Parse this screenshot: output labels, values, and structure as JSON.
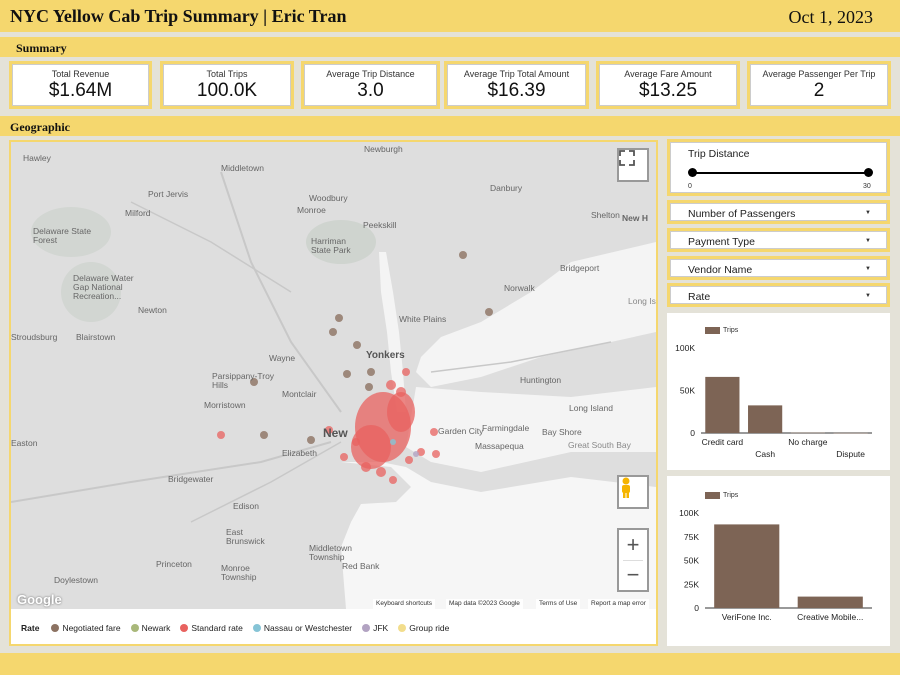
{
  "header": {
    "title": "NYC Yellow Cab Trip Summary | Eric Tran",
    "date": "Oct 1, 2023"
  },
  "sections": {
    "summary": "Summary",
    "geographic": "Geographic"
  },
  "kpis": [
    {
      "label": "Total Revenue",
      "value": "$1.64M"
    },
    {
      "label": "Total Trips",
      "value": "100.0K"
    },
    {
      "label": "Average Trip Distance",
      "value": "3.0"
    },
    {
      "label": "Average Trip Total Amount",
      "value": "$16.39"
    },
    {
      "label": "Average Fare Amount",
      "value": "$13.25"
    },
    {
      "label": "Average Passenger Per Trip",
      "value": "2"
    }
  ],
  "map": {
    "places": [
      "Hawley",
      "Middletown",
      "Newburgh",
      "Danbury",
      "Port Jervis",
      "Woodbury",
      "Milford",
      "Monroe",
      "Shelton",
      "New H",
      "Delaware State Forest",
      "Peekskill",
      "Harriman State Park",
      "Bridgeport",
      "Delaware Water Gap National Recreation...",
      "Norwalk",
      "Long Isl",
      "Newton",
      "White Plains",
      "Stroudsburg",
      "Blairstown",
      "Yonkers",
      "Wayne",
      "Huntington",
      "Parsippany-Troy Hills",
      "Montclair",
      "Morristown",
      "Long Island",
      "Farmingdale",
      "Elizabeth",
      "Garden City",
      "Bay Shore",
      "Massapequa",
      "Easton",
      "Great South Bay",
      "Bridgewater",
      "Edison",
      "East Brunswick",
      "Middletown Township",
      "Princeton",
      "Red Bank",
      "Monroe Township",
      "Doylestown",
      "New"
    ],
    "google": "Google",
    "attribution": [
      "Keyboard shortcuts",
      "Map data ©2023 Google",
      "Terms of Use",
      "Report a map error"
    ]
  },
  "legend": {
    "title": "Rate",
    "items": [
      {
        "label": "Negotiated fare",
        "color": "#8c7262"
      },
      {
        "label": "Newark",
        "color": "#a9b87a"
      },
      {
        "label": "Standard rate",
        "color": "#e8625f"
      },
      {
        "label": "Nassau or Westchester",
        "color": "#86c4d6"
      },
      {
        "label": "JFK",
        "color": "#b2a3c2"
      },
      {
        "label": "Group ride",
        "color": "#f2dd8c"
      }
    ]
  },
  "filters": {
    "trip_distance": {
      "label": "Trip Distance",
      "min": "0",
      "max": "30"
    },
    "dropdowns": [
      "Number of Passengers",
      "Payment Type",
      "Vendor Name",
      "Rate"
    ]
  },
  "chart_data": [
    {
      "type": "bar",
      "categories": [
        "Credit card",
        "Cash",
        "No charge",
        "Dispute"
      ],
      "series": [
        {
          "name": "Trips",
          "values": [
            66000,
            32500,
            400,
            200
          ]
        }
      ],
      "yticks": [
        "100K",
        "50K",
        "0"
      ],
      "ylim": [
        0,
        100000
      ],
      "color": "#7d6455"
    },
    {
      "type": "bar",
      "categories": [
        "VeriFone Inc.",
        "Creative Mobile..."
      ],
      "series": [
        {
          "name": "Trips",
          "values": [
            88000,
            12000
          ]
        }
      ],
      "yticks": [
        "100K",
        "75K",
        "50K",
        "25K",
        "0"
      ],
      "ylim": [
        0,
        100000
      ],
      "color": "#7d6455"
    }
  ]
}
